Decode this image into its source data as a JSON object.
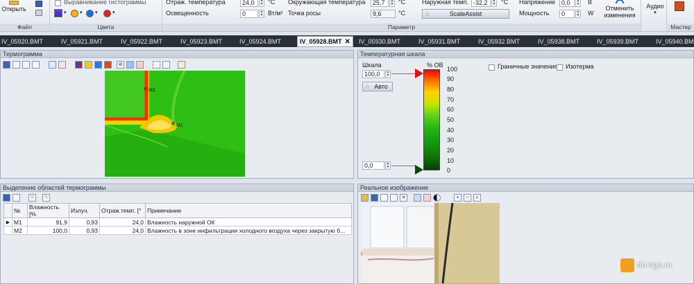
{
  "ribbon": {
    "file": {
      "title": "Файл",
      "open_label": "Открыть"
    },
    "colors": {
      "title": "Цвета",
      "histogram_label": "Выравнивание гистограммы"
    },
    "params": {
      "title": "Параметр",
      "refl_temp_label": "Отраж. температура",
      "refl_temp_value": "24,0",
      "refl_temp_unit": "°C",
      "emissivity_label": "Освещенность",
      "emissivity_value": "0",
      "emissivity_unit": "Вт/м²",
      "ambient_label": "Окружающая температура",
      "ambient_value": "25,7",
      "ambient_unit": "°C",
      "dew_label": "Точка росы",
      "dew_value": "9,6",
      "dew_unit": "°C",
      "outside_label": "Наружная темп.",
      "outside_value": "-32,2",
      "outside_unit": "°C",
      "scaleassist_label": "ScaleAssist",
      "voltage_label": "Напряжение",
      "voltage_value": "0,0",
      "voltage_unit": "B",
      "power_label": "Мощность",
      "power_value": "0",
      "power_unit": "W",
      "undo_line1": "Отменить",
      "undo_line2": "изменения"
    },
    "audio_label": "Аудио",
    "master_title": "Мастер"
  },
  "tabs": [
    {
      "label": "IV_05920.BMT"
    },
    {
      "label": "IV_05921.BMT"
    },
    {
      "label": "IV_05922.BMT"
    },
    {
      "label": "IV_05923.BMT"
    },
    {
      "label": "IV_05924.BMT"
    },
    {
      "label": "IV_05928.BMT",
      "active": true
    },
    {
      "label": "IV_05930.BMT"
    },
    {
      "label": "IV_05931.BMT"
    },
    {
      "label": "IV_05932.BMT"
    },
    {
      "label": "IV_05938.BMT"
    },
    {
      "label": "IV_05939.BMT"
    },
    {
      "label": "IV_05940.BMT"
    }
  ],
  "thermogram": {
    "title": "Термограмма",
    "marker1": "M1",
    "marker2": "M2"
  },
  "scale": {
    "title": "Температурная шкала",
    "scale_label": "Шкала",
    "max_value": "100,0",
    "min_value": "0,0",
    "auto_label": "Авто",
    "unit": "% OB",
    "ticks": [
      "100",
      "90",
      "80",
      "70",
      "60",
      "50",
      "40",
      "30",
      "20",
      "10",
      "0"
    ],
    "limits_label": "Граничные значения",
    "isotherm_label": "Изотерма"
  },
  "regions": {
    "title": "Выделение областей термограммы",
    "headers": [
      "№",
      "Влажность [%",
      "Излуч.",
      "Отраж.темп. [°",
      "Примечание"
    ],
    "rows": [
      {
        "id": "M1",
        "humidity": "91,9",
        "emissivity": "0,93",
        "refl": "24,0",
        "note": "Влажность наружной ОК"
      },
      {
        "id": "M2",
        "humidity": "100,0",
        "emissivity": "0,93",
        "refl": "24,0",
        "note": "Влажность в зоне инфильтрации холодного воздуха через закрытую б..."
      }
    ]
  },
  "photo": {
    "title": "Реальное изображение",
    "watermark": "do.ngs.ru"
  }
}
